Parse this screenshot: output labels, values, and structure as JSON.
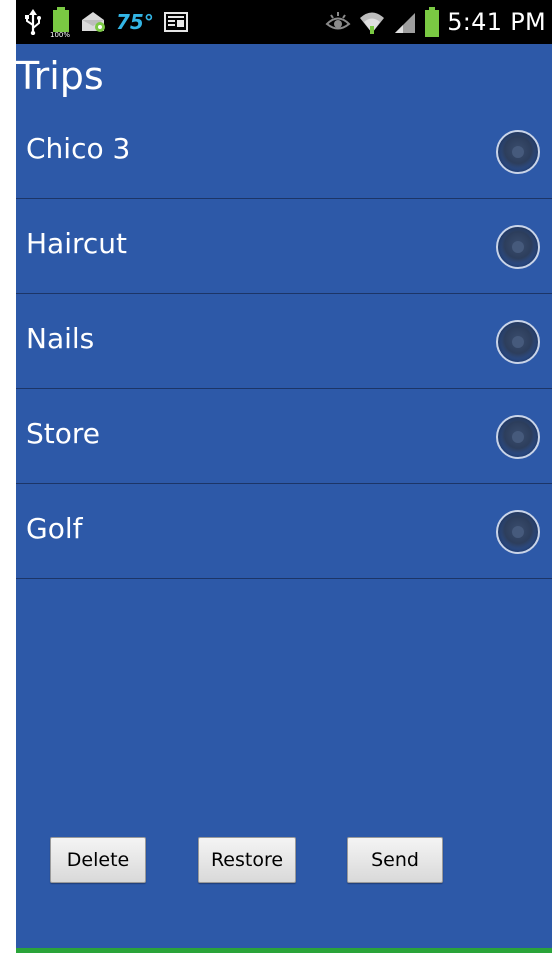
{
  "status_bar": {
    "temperature": "75°",
    "time": "5:41 PM",
    "icons": [
      "usb-icon",
      "battery-full-icon",
      "email-notification-icon",
      "news-icon",
      "eye-icon",
      "wifi-icon",
      "signal-icon",
      "battery-icon"
    ],
    "battery_label": "100%"
  },
  "page": {
    "title": "Trips"
  },
  "trips": [
    {
      "label": "Chico 3",
      "selected": false
    },
    {
      "label": "Haircut",
      "selected": false
    },
    {
      "label": "Nails",
      "selected": false
    },
    {
      "label": "Store",
      "selected": false
    },
    {
      "label": "Golf",
      "selected": false
    }
  ],
  "actions": {
    "delete_label": "Delete",
    "restore_label": "Restore",
    "send_label": "Send"
  },
  "colors": {
    "background": "#2d59a8",
    "status_bar": "#000000",
    "temperature": "#33b5e5",
    "bottom_accent": "#2aa43a"
  }
}
